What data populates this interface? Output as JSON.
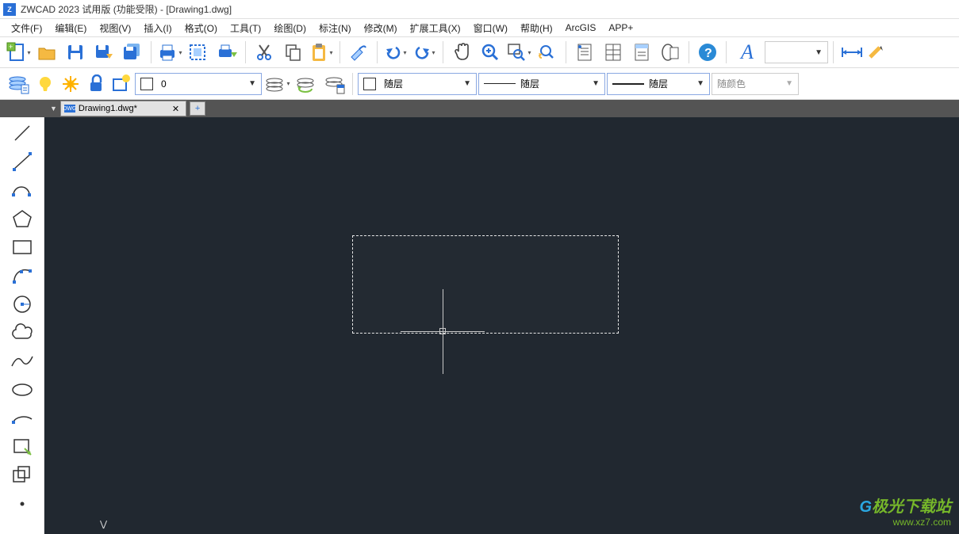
{
  "titlebar": {
    "text": "ZWCAD 2023 试用版 (功能受限) - [Drawing1.dwg]"
  },
  "menu": {
    "file": "文件(F)",
    "edit": "编辑(E)",
    "view": "视图(V)",
    "insert": "插入(I)",
    "format": "格式(O)",
    "tools": "工具(T)",
    "draw": "绘图(D)",
    "dimension": "标注(N)",
    "modify": "修改(M)",
    "ext": "扩展工具(X)",
    "window": "窗口(W)",
    "help": "帮助(H)",
    "arcgis": "ArcGIS",
    "app": "APP+"
  },
  "layer": {
    "current": "0"
  },
  "linetype": {
    "label": "随层"
  },
  "lineweight": {
    "label": "随层"
  },
  "plotstyle": {
    "label": "随层"
  },
  "color": {
    "label": "随颜色"
  },
  "tabs": {
    "active": "Drawing1.dwg*"
  },
  "font": {
    "letter": "A"
  },
  "watermark": {
    "brand_accent": "G",
    "brand_text": "极光下载站",
    "url": "www.xz7.com"
  },
  "icons": {
    "new": "new",
    "open": "open",
    "save": "save",
    "saveas": "saveas",
    "saveall": "saveall",
    "print": "print",
    "printprev": "printprev",
    "plot": "plot",
    "cut": "cut",
    "copy": "copy",
    "paste": "paste",
    "eraser": "eraser",
    "undo": "undo",
    "redo": "redo",
    "pan": "pan",
    "zoom": "zoom",
    "zoomwin": "zoomwin",
    "zoomprev": "zoomprev",
    "props": "props",
    "propsgrid": "propsgrid",
    "sheet": "sheet",
    "wipeout": "wipeout",
    "help": "help",
    "dim": "dim"
  }
}
